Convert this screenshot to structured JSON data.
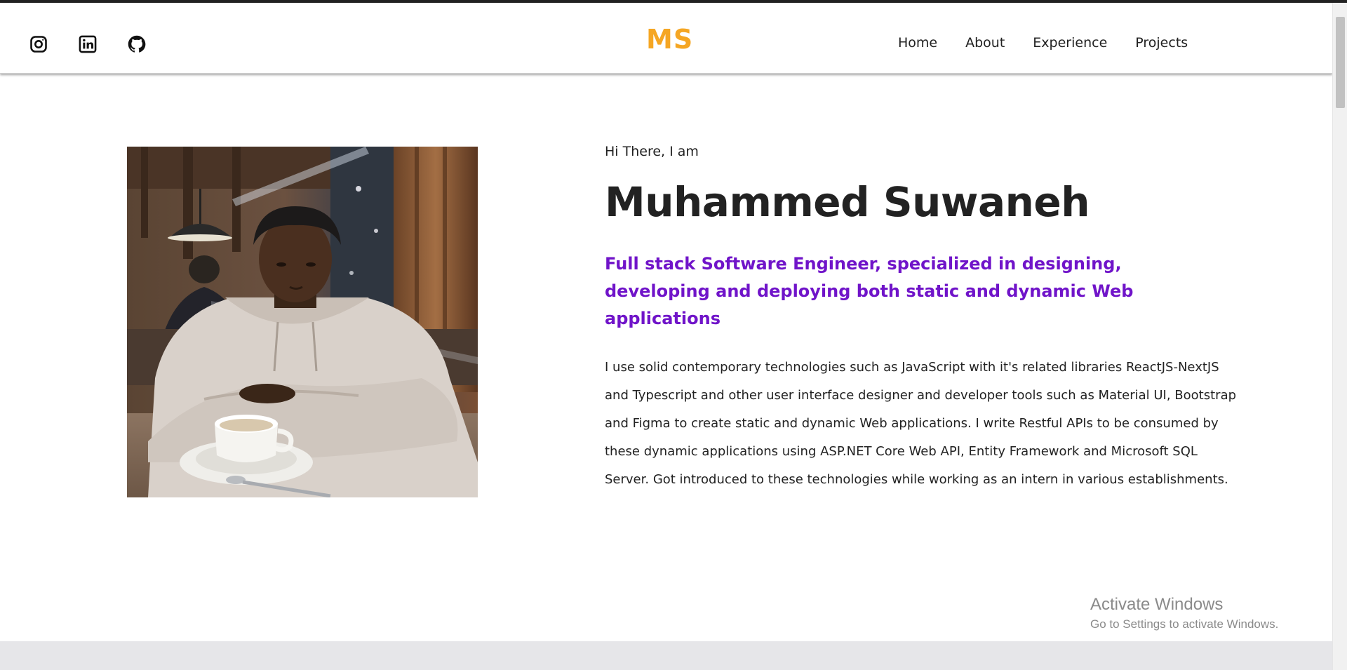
{
  "header": {
    "logo": "MS",
    "social": [
      {
        "name": "instagram",
        "icon": "instagram-icon"
      },
      {
        "name": "linkedin",
        "icon": "linkedin-icon"
      },
      {
        "name": "github",
        "icon": "github-icon"
      }
    ],
    "nav": [
      "Home",
      "About",
      "Experience",
      "Projects"
    ]
  },
  "hero": {
    "greeting": "Hi There, I am",
    "name": "Muhammed Suwaneh",
    "tagline": "Full stack Software Engineer, specialized in designing, developing and deploying both static and dynamic Web applications",
    "bio": "I use solid contemporary technologies such as JavaScript with it's related libraries ReactJS-NextJS and Typescript and other user interface designer and developer tools such as Material UI, Bootstrap and Figma to create static and dynamic Web applications. I write Restful APIs to be consumed by these dynamic applications using ASP.NET Core Web API, Entity Framework and Microsoft SQL Server. Got introduced to these technologies while working as an intern in various establishments."
  },
  "watermark": {
    "title": "Activate Windows",
    "subtitle": "Go to Settings to activate Windows."
  },
  "colors": {
    "logo": "#f5a623",
    "tagline": "#7014c9",
    "text": "#222222"
  }
}
